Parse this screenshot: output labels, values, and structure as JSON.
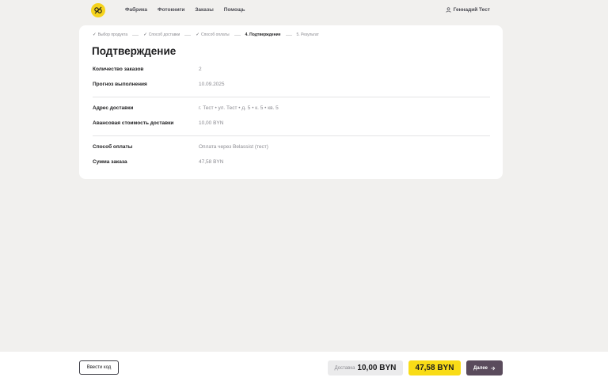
{
  "header": {
    "logo_icon": "photo-bee-logo",
    "nav": [
      "Фабрика",
      "Фотокниги",
      "Заказы",
      "Помощь"
    ],
    "user_name": "Геннадий Тест"
  },
  "steps": [
    {
      "label": "Выбор продукта",
      "done": true
    },
    {
      "label": "Способ доставки",
      "done": true
    },
    {
      "label": "Способ оплаты",
      "done": true
    },
    {
      "label": "4. Подтверждение",
      "active": true
    },
    {
      "label": "5. Результат"
    }
  ],
  "title": "Подтверждение",
  "details": {
    "orders_count": {
      "label": "Количество заказов",
      "value": "2"
    },
    "forecast": {
      "label": "Прогноз выполнения",
      "value": "10.09.2025"
    },
    "address": {
      "label": "Адрес доставки",
      "value": "г. Тест • ул. Тест • д. 5 • к. 5 • кв. 5"
    },
    "delivery_cost": {
      "label": "Авансовая стоимость доставки",
      "value": "10,00 BYN"
    },
    "payment_method": {
      "label": "Способ оплаты",
      "value": "Оплата через Belassist (тест)"
    },
    "order_sum": {
      "label": "Сумма заказа",
      "value": "47,58 BYN"
    }
  },
  "footer": {
    "code_button": "Ввести код",
    "delivery_label": "Доставка",
    "delivery_value": "10,00 BYN",
    "total": "47,58 BYN",
    "next_button": "Далее"
  },
  "colors": {
    "accent_yellow": "#f9dc16",
    "button_dark": "#5a4b5c",
    "background": "#f1f0ee"
  }
}
